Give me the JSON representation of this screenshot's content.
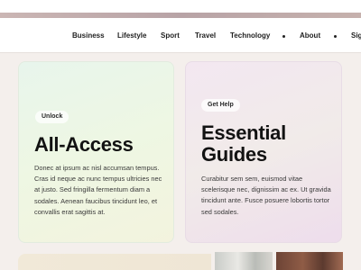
{
  "nav": {
    "items": [
      {
        "label": "Business"
      },
      {
        "label": "Lifestyle"
      },
      {
        "label": "Sport"
      },
      {
        "label": "Travel"
      },
      {
        "label": "Technology"
      },
      {
        "label": "About"
      },
      {
        "label": "Sig"
      }
    ]
  },
  "cards": [
    {
      "tag": "Unlock",
      "title": "All-Access",
      "body": "Donec at ipsum ac nisl accumsan tempus. Cras id neque ac nunc tempus ultricies nec at justo. Sed fringilla fermentum diam a sodales. Aenean faucibus tincidunt leo, et convallis erat sagittis at."
    },
    {
      "tag": "Get Help",
      "title": "Essential Guides",
      "body": "Curabitur sem sem, euismod vitae scelerisque nec, dignissim ac ex. Ut gravida tincidunt ante. Fusce posuere lobortis tortor sed sodales."
    }
  ]
}
